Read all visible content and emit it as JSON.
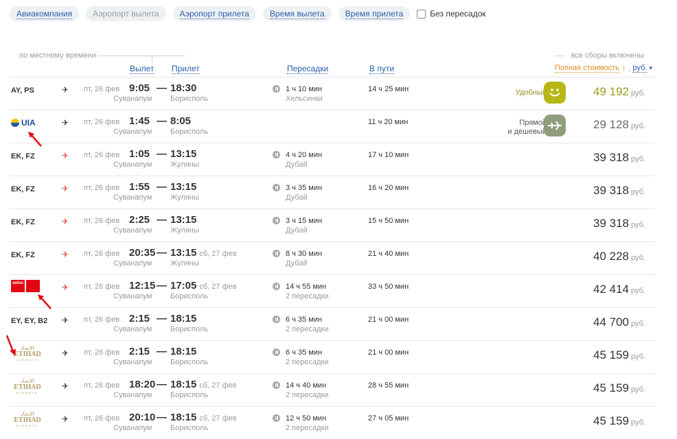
{
  "filters": {
    "airline": "Авиакомпания",
    "dep_airport": "Аэропорт вылета",
    "arr_airport": "Аэропорт прилета",
    "dep_time": "Время вылета",
    "arr_time": "Время прилета",
    "nonstop": "Без пересадок"
  },
  "header": {
    "local_time": "по местному времени",
    "dep": "Вылет",
    "arr": "Прилет",
    "stops": "Пересадки",
    "duration": "В пути",
    "fees": "все сборы включены",
    "total": "Полная стоимость",
    "sort_arrow": "↑",
    "currency": "руб.",
    "caret": "▾"
  },
  "icons": {
    "plane": "✈",
    "pause": "pause-icon"
  },
  "rows": [
    {
      "airline": "AY, PS",
      "logo": "text",
      "plane": "dark",
      "date": "пт, 26 фев",
      "dep": "9:05",
      "dep_ap": "Суванапум",
      "arr": "18:30",
      "arr_day": "",
      "arr_ap": "Борисполь",
      "stops": "1 ч 10 мин",
      "stops_info": "Хельсинки",
      "duration": "14 ч 25 мин",
      "badge": "Удобный",
      "badge_kind": "yellow",
      "price": "49 192",
      "cur": "руб."
    },
    {
      "airline": "UIA",
      "logo": "uia",
      "plane": "dark",
      "date": "пт, 26 фев",
      "dep": "1:45",
      "dep_ap": "Суванапум",
      "arr": "8:05",
      "arr_day": "",
      "arr_ap": "Борисполь",
      "stops": "",
      "stops_info": "",
      "duration": "11 ч 20 мин",
      "badge1": "Прямой",
      "badge2": "и дешевый",
      "badge_kind": "gray",
      "price": "29 128",
      "cur": "руб."
    },
    {
      "airline": "EK, FZ",
      "logo": "text",
      "plane": "red",
      "date": "пт, 26 фев",
      "dep": "1:05",
      "dep_ap": "Суванапум",
      "arr": "13:15",
      "arr_day": "",
      "arr_ap": "Жуляны",
      "stops": "4 ч 20 мин",
      "stops_info": "Дубай",
      "duration": "17 ч 10 мин",
      "price": "39 318",
      "cur": "руб."
    },
    {
      "airline": "EK, FZ",
      "logo": "text",
      "plane": "red",
      "date": "пт, 26 фев",
      "dep": "1:55",
      "dep_ap": "Суванапум",
      "arr": "13:15",
      "arr_day": "",
      "arr_ap": "Жуляны",
      "stops": "3 ч 35 мин",
      "stops_info": "Дубай",
      "duration": "16 ч 20 мин",
      "price": "39 318",
      "cur": "руб."
    },
    {
      "airline": "EK, FZ",
      "logo": "text",
      "plane": "red",
      "date": "пт, 26 фев",
      "dep": "2:25",
      "dep_ap": "Суванапум",
      "arr": "13:15",
      "arr_day": "",
      "arr_ap": "Жуляны",
      "stops": "3 ч 15 мин",
      "stops_info": "Дубай",
      "duration": "15 ч 50 мин",
      "price": "39 318",
      "cur": "руб."
    },
    {
      "airline": "EK, FZ",
      "logo": "text",
      "plane": "red",
      "date": "пт, 26 фев",
      "dep": "20:35",
      "dep_ap": "Суванапум",
      "arr": "13:15",
      "arr_day": "сб, 27 фев",
      "arr_ap": "Жуляны",
      "stops": "8 ч 30 мин",
      "stops_info": "Дубай",
      "duration": "21 ч 40 мин",
      "price": "40 228",
      "cur": "руб."
    },
    {
      "airline": "swiss",
      "logo": "swiss",
      "plane": "red",
      "date": "пт, 26 фев",
      "dep": "12:15",
      "dep_ap": "Суванапум",
      "arr": "17:05",
      "arr_day": "сб, 27 фев",
      "arr_ap": "Борисполь",
      "stops": "14 ч 55 мин",
      "stops_info": "2 пересадки",
      "duration": "33 ч 50 мин",
      "price": "42 414",
      "cur": "руб."
    },
    {
      "airline": "EY, EY, B2",
      "logo": "text",
      "plane": "dark",
      "date": "пт, 26 фев",
      "dep": "2:15",
      "dep_ap": "Суванапум",
      "arr": "18:15",
      "arr_day": "",
      "arr_ap": "Борисполь",
      "stops": "6 ч 35 мин",
      "stops_info": "2 пересадки",
      "duration": "21 ч 00 мин",
      "price": "44 700",
      "cur": "руб."
    },
    {
      "airline": "ETIHAD",
      "logo": "etihad",
      "plane": "dark",
      "date": "пт, 26 фев",
      "dep": "2:15",
      "dep_ap": "Суванапум",
      "arr": "18:15",
      "arr_day": "",
      "arr_ap": "Борисполь",
      "stops": "6 ч 35 мин",
      "stops_info": "2 пересадки",
      "duration": "21 ч 00 мин",
      "price": "45 159",
      "cur": "руб."
    },
    {
      "airline": "ETIHAD",
      "logo": "etihad",
      "plane": "dark",
      "date": "пт, 26 фев",
      "dep": "18:20",
      "dep_ap": "Суванапум",
      "arr": "18:15",
      "arr_day": "сб, 27 фев",
      "arr_ap": "Борисполь",
      "stops": "14 ч 40 мин",
      "stops_info": "2 пересадки",
      "duration": "28 ч 55 мин",
      "price": "45 159",
      "cur": "руб."
    },
    {
      "airline": "ETIHAD",
      "logo": "etihad",
      "plane": "dark",
      "date": "пт, 26 фев",
      "dep": "20:10",
      "dep_ap": "Суванапум",
      "arr": "18:15",
      "arr_day": "сб, 27 фев",
      "arr_ap": "Борисполь",
      "stops": "12 ч 50 мин",
      "stops_info": "2 пересадки",
      "duration": "27 ч 05 мин",
      "price": "45 159",
      "cur": "руб."
    }
  ]
}
